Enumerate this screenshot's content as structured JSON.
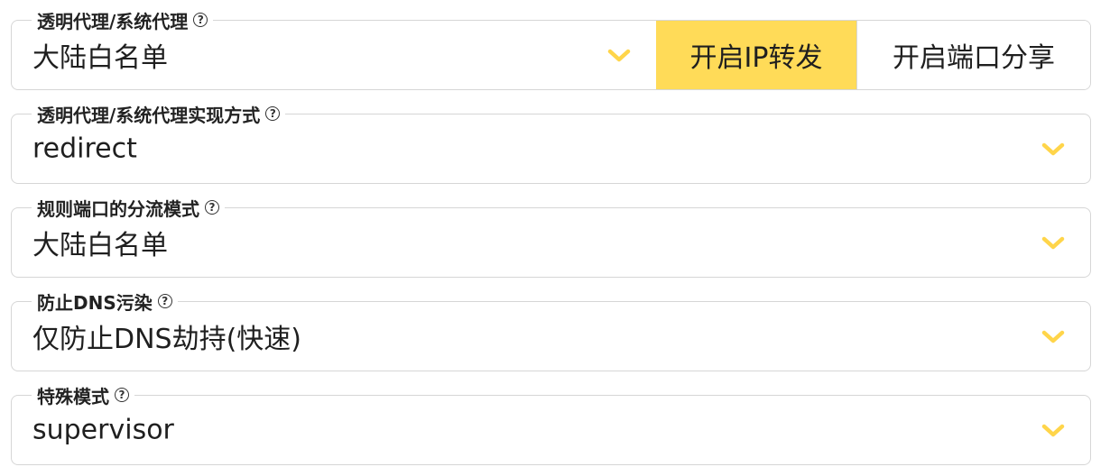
{
  "accent_color": "#ffdb58",
  "fields": [
    {
      "label": "透明代理/系统代理",
      "value": "大陆白名单",
      "help_icon": "?",
      "chevron_icon": "chevron-down-icon"
    },
    {
      "label": "透明代理/系统代理实现方式",
      "value": "redirect",
      "help_icon": "?",
      "chevron_icon": "chevron-down-icon"
    },
    {
      "label": "规则端口的分流模式",
      "value": "大陆白名单",
      "help_icon": "?",
      "chevron_icon": "chevron-down-icon"
    },
    {
      "label": "防止DNS污染",
      "value": "仅防止DNS劫持(快速)",
      "help_icon": "?",
      "chevron_icon": "chevron-down-icon"
    },
    {
      "label": "特殊模式",
      "value": "supervisor",
      "help_icon": "?",
      "chevron_icon": "chevron-down-icon"
    }
  ],
  "buttons": {
    "ip_forward": "开启IP转发",
    "port_sharing": "开启端口分享"
  }
}
